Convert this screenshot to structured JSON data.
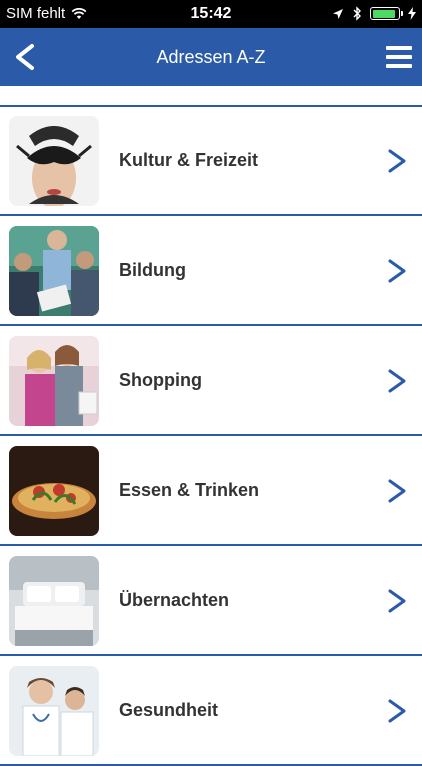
{
  "status_bar": {
    "carrier": "SIM fehlt",
    "time": "15:42"
  },
  "nav": {
    "title": "Adressen A-Z",
    "back_icon": "chevron-left-icon",
    "menu_icon": "hamburger-menu-icon"
  },
  "categories": [
    {
      "label": "Kultur & Freizeit",
      "thumb": "masquerade-mask-photo"
    },
    {
      "label": "Bildung",
      "thumb": "classroom-photo"
    },
    {
      "label": "Shopping",
      "thumb": "shopping-women-photo"
    },
    {
      "label": "Essen & Trinken",
      "thumb": "pizza-photo"
    },
    {
      "label": "Übernachten",
      "thumb": "hotel-bed-photo"
    },
    {
      "label": "Gesundheit",
      "thumb": "doctors-photo"
    }
  ],
  "colors": {
    "accent": "#2a5aa8",
    "chevron": "#2a5aa8",
    "label": "#333333",
    "battery": "#4cd964"
  }
}
